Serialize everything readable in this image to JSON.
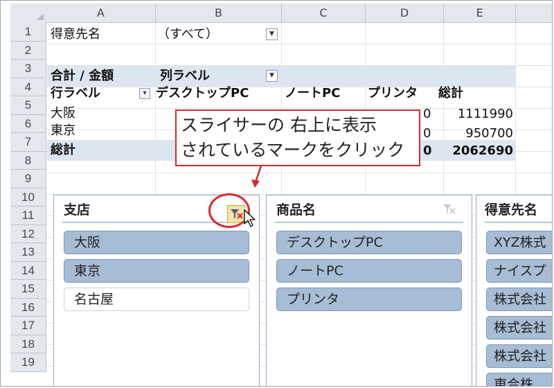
{
  "columns": [
    "A",
    "B",
    "C",
    "D",
    "E"
  ],
  "rows": [
    "1",
    "2",
    "3",
    "4",
    "5",
    "6",
    "7",
    "8",
    "9",
    "10",
    "11",
    "12",
    "13",
    "14",
    "15",
    "16",
    "17",
    "18",
    "19"
  ],
  "pivot": {
    "filter_label": "得意先名",
    "filter_value": "（すべて）",
    "sum_label": "合計 / 金額",
    "col_label": "列ラベル",
    "row_label": "行ラベル",
    "col_headers": [
      "デスクトップPC",
      "ノートPC",
      "プリンタ",
      "総計"
    ],
    "rows": [
      {
        "label": "大阪",
        "d_partial": "0",
        "total": "1111990"
      },
      {
        "label": "東京",
        "d_partial": "0",
        "total": "950700"
      },
      {
        "label": "総計",
        "d_partial": "0",
        "total": "2062690"
      }
    ]
  },
  "callout": {
    "line1": "スライサーの 右上に表示",
    "line2": "されているマークをクリック",
    "color": "#d9262b"
  },
  "slicers": [
    {
      "title": "支店",
      "items": [
        {
          "label": "大阪",
          "selected": true
        },
        {
          "label": "東京",
          "selected": true
        },
        {
          "label": "名古屋",
          "selected": false
        }
      ]
    },
    {
      "title": "商品名",
      "items": [
        {
          "label": "デスクトップPC",
          "selected": true
        },
        {
          "label": "ノートPC",
          "selected": true
        },
        {
          "label": "プリンタ",
          "selected": true
        }
      ]
    },
    {
      "title": "得意先名",
      "items": [
        {
          "label": "XYZ株式",
          "selected": true
        },
        {
          "label": "ナイスプ",
          "selected": true
        },
        {
          "label": "株式会社",
          "selected": true
        },
        {
          "label": "株式会社",
          "selected": true
        },
        {
          "label": "株式会社",
          "selected": true
        },
        {
          "label": "東合株",
          "selected": true
        }
      ]
    }
  ],
  "icons": {
    "clear_filter": "clear-filter-icon",
    "dropdown": "dropdown-arrow-icon",
    "row_filter": "filter-icon",
    "cursor": "mouse-cursor-icon"
  }
}
